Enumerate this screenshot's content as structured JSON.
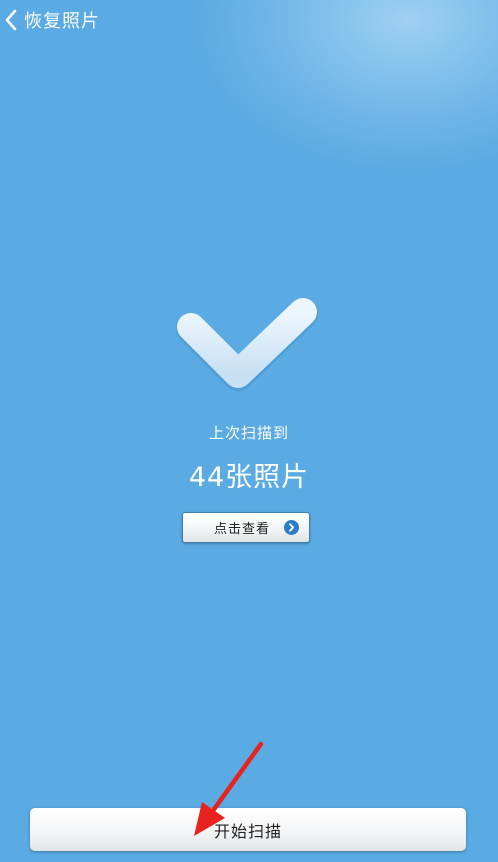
{
  "header": {
    "back_icon": "chevron-left-icon",
    "title": "恢复照片"
  },
  "result": {
    "icon": "checkmark-icon",
    "scan_label": "上次扫描到",
    "photo_count": "44张照片",
    "view_button_label": "点击查看",
    "view_button_icon": "chevron-right-circle-icon"
  },
  "footer": {
    "start_button_label": "开始扫描"
  },
  "annotation": {
    "icon": "red-arrow-icon",
    "color": "#e8231f"
  },
  "colors": {
    "background": "#5aaae3",
    "accent": "#2a7dc9"
  }
}
